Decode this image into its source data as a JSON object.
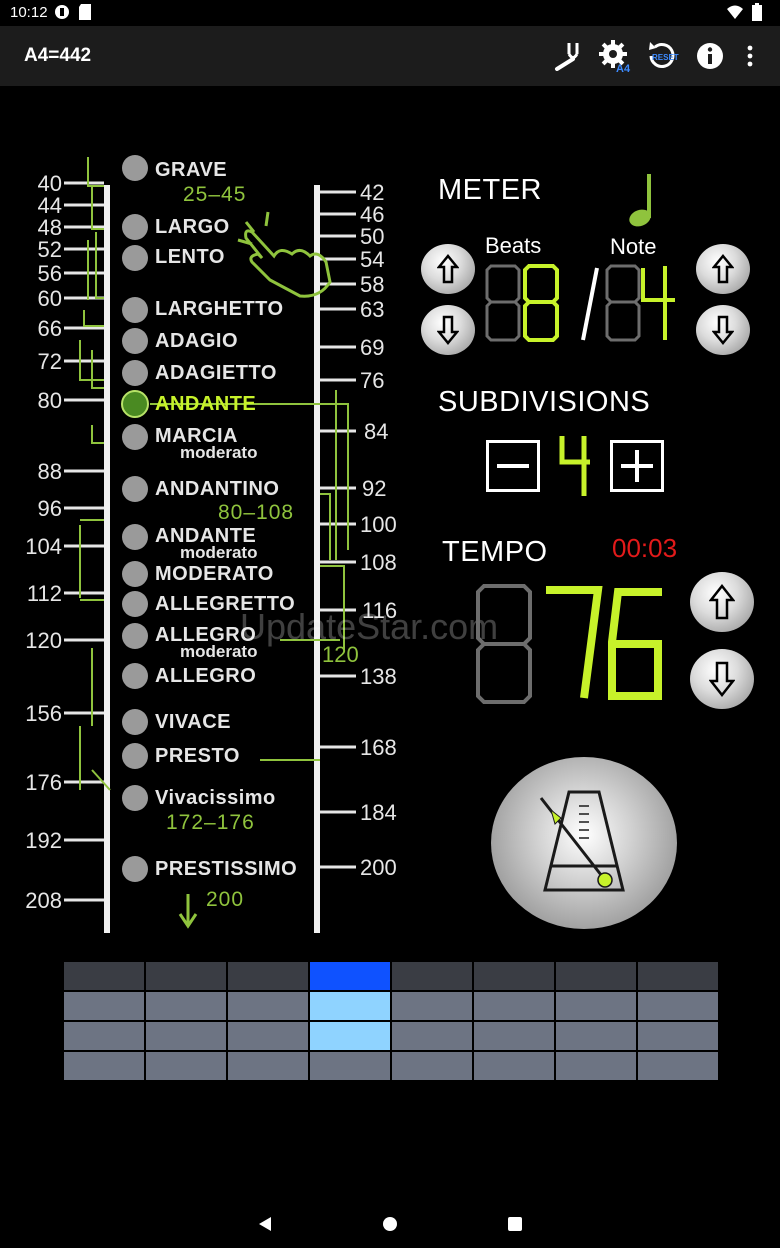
{
  "status_bar": {
    "time": "10:12"
  },
  "app_bar": {
    "title": "A4=442",
    "actions": [
      "tuning-fork-icon",
      "settings-a4-icon",
      "reset-icon",
      "info-icon",
      "overflow-menu-icon"
    ]
  },
  "tempo_scale": {
    "left_numbers": [
      "40",
      "44",
      "48",
      "52",
      "56",
      "60",
      "66",
      "72",
      "80",
      "88",
      "96",
      "104",
      "112",
      "120",
      "156",
      "176",
      "192",
      "208"
    ],
    "right_numbers": [
      "42",
      "46",
      "50",
      "54",
      "58",
      "63",
      "69",
      "76",
      "84",
      "92",
      "100",
      "108",
      "116",
      "120",
      "138",
      "168",
      "184",
      "200"
    ],
    "markings": [
      {
        "label": "GRAVE",
        "sub": "",
        "selected": false
      },
      {
        "label": "LARGO",
        "sub": "",
        "selected": false
      },
      {
        "label": "LENTO",
        "sub": "",
        "selected": false
      },
      {
        "label": "LARGHETTO",
        "sub": "",
        "selected": false
      },
      {
        "label": "ADAGIO",
        "sub": "",
        "selected": false
      },
      {
        "label": "ADAGIETTO",
        "sub": "",
        "selected": false
      },
      {
        "label": "ANDANTE",
        "sub": "",
        "selected": true
      },
      {
        "label": "MARCIA",
        "sub": "moderato",
        "selected": false
      },
      {
        "label": "ANDANTINO",
        "sub": "",
        "selected": false
      },
      {
        "label": "ANDANTE",
        "sub": "moderato",
        "selected": false
      },
      {
        "label": "MODERATO",
        "sub": "",
        "selected": false
      },
      {
        "label": "ALLEGRETTO",
        "sub": "",
        "selected": false
      },
      {
        "label": "ALLEGRO",
        "sub": "moderato",
        "selected": false
      },
      {
        "label": "ALLEGRO",
        "sub": "",
        "selected": false
      },
      {
        "label": "VIVACE",
        "sub": "",
        "selected": false
      },
      {
        "label": "PRESTO",
        "sub": "",
        "selected": false
      },
      {
        "label": "Vivacissimo",
        "sub": "",
        "selected": false
      },
      {
        "label": "PRESTISSIMO",
        "sub": "",
        "selected": false
      }
    ],
    "ranges": [
      "25–45",
      "80–108",
      "172–176",
      "200"
    ]
  },
  "meter": {
    "title": "METER",
    "beats_label": "Beats",
    "note_label": "Note",
    "beats_value": "8",
    "beats_ghost": "88",
    "note_value": "4",
    "note_ghost": "84",
    "separator": "/"
  },
  "subdivisions": {
    "title": "SUBDIVISIONS",
    "value": "4"
  },
  "tempo": {
    "title": "TEMPO",
    "timer": "00:03",
    "value": "76",
    "ghost": "876"
  },
  "beat_grid": {
    "columns": 8,
    "rows": 4,
    "active_column": 4,
    "active_rows": 3
  },
  "colors": {
    "accent_green": "#c7f22a",
    "scale_green": "#8fc33d",
    "timer_red": "#e21a1a",
    "grid_active_top": "#0f52ff",
    "grid_active": "#8fd3ff",
    "grid_top": "#3a3d44",
    "grid_cell": "#6d7483"
  },
  "watermark": "UpdateStar.com"
}
